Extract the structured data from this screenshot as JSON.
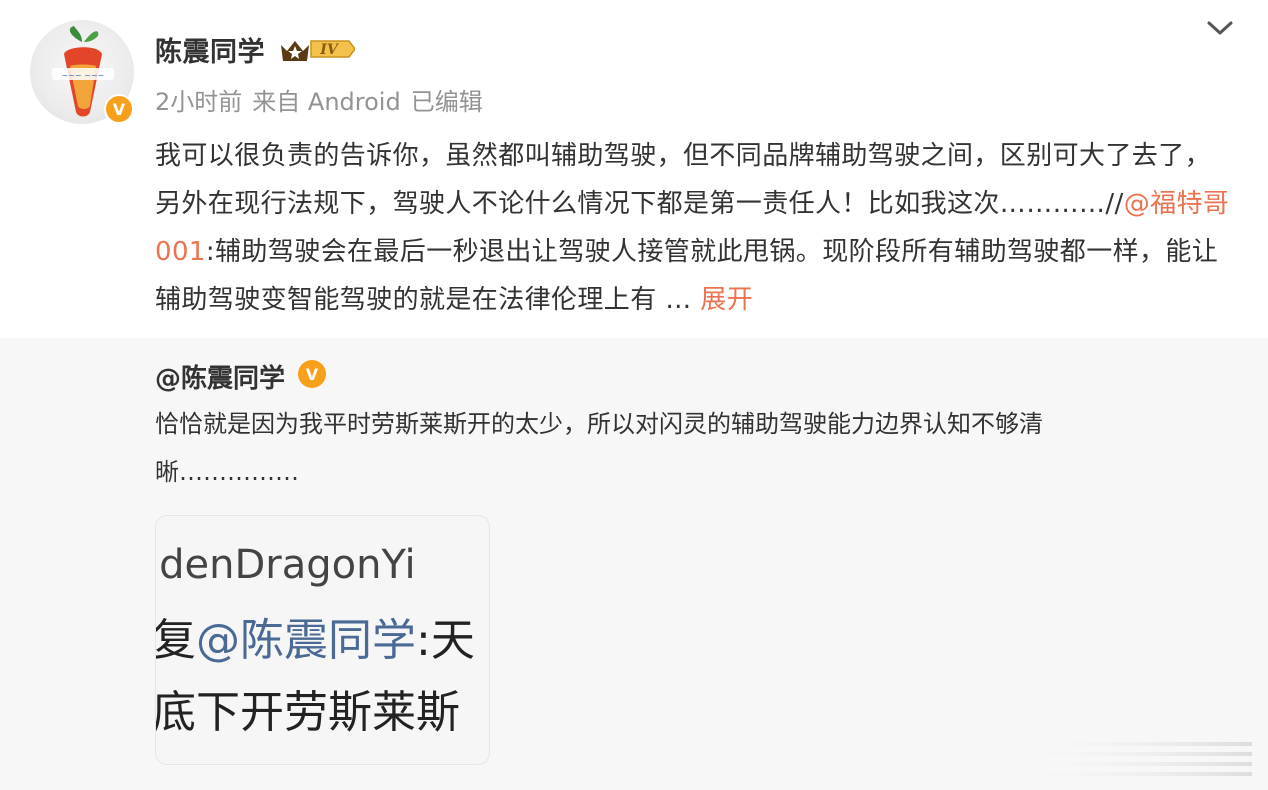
{
  "post": {
    "author": "陈震同学",
    "level_badge": "IV",
    "meta": {
      "time": "2小时前",
      "source": "来自 Android",
      "edited": "已编辑"
    },
    "text_before_mention": "我可以很负责的告诉你，虽然都叫辅助驾驶，但不同品牌辅助驾驶之间，区别可大了去了，另外在现行法规下，驾驶人不论什么情况下都是第一责任人！比如我这次…………//",
    "mention": "@福特哥001",
    "text_after_mention": ":辅助驾驶会在最后一秒退出让驾驶人接管就此甩锅。现阶段所有辅助驾驶都一样，能让辅助驾驶变智能驾驶的就是在法律伦理上有 …",
    "expand_label": "展开"
  },
  "repost": {
    "author": "@陈震同学",
    "text": "恰恰就是因为我平时劳斯莱斯开的太少，所以对闪灵的辅助驾驶能力边界认知不够清晰……………",
    "image": {
      "line1": "ldenDragonYi",
      "line2_prefix": "复",
      "line2_mention": "@陈震同学",
      "line2_suffix": ":天",
      "line3": "底下开劳斯莱斯"
    }
  },
  "colors": {
    "accent_orange": "#eb7350",
    "verified_gold": "#f7a11a",
    "repost_bg": "#f7f7f7",
    "meta_gray": "#939393"
  },
  "icons": {
    "avatar": "carrot-avatar",
    "verified": "verified-v-icon",
    "level": "crown-level-icon",
    "collapse": "chevron-down-icon"
  }
}
